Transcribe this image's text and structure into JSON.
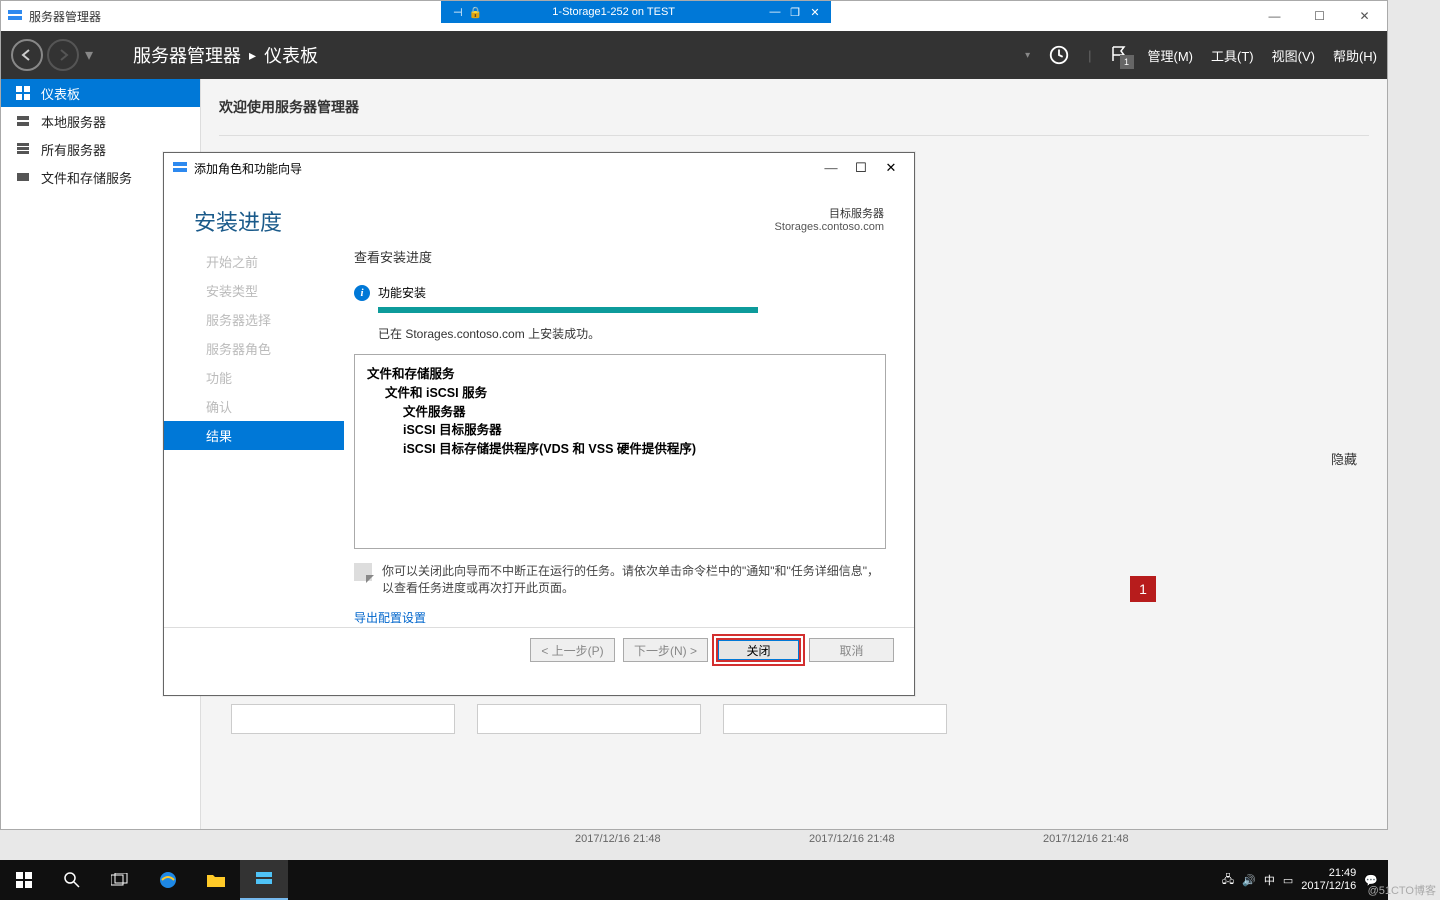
{
  "outer_window": {
    "title": "服务器管理器"
  },
  "remote_bar": {
    "title": "1-Storage1-252 on TEST"
  },
  "sm_header": {
    "breadcrumb": {
      "part1": "服务器管理器",
      "part2": "仪表板"
    },
    "menu": {
      "manage": "管理(M)",
      "tools": "工具(T)",
      "view": "视图(V)",
      "help": "帮助(H)"
    },
    "flag_count": "1"
  },
  "sidebar": {
    "items": [
      {
        "label": "仪表板"
      },
      {
        "label": "本地服务器"
      },
      {
        "label": "所有服务器"
      },
      {
        "label": "文件和存储服务"
      }
    ]
  },
  "main": {
    "welcome": "欢迎使用服务器管理器",
    "hide": "隐藏",
    "date1": "2017/12/16 21:48",
    "date2": "2017/12/16 21:48",
    "date3": "2017/12/16 21:48",
    "red_badge": "1"
  },
  "wizard": {
    "title": "添加角色和功能向导",
    "heading": "安装进度",
    "target_label": "目标服务器",
    "target_value": "Storages.contoso.com",
    "steps": {
      "before": "开始之前",
      "type": "安装类型",
      "server_sel": "服务器选择",
      "server_role": "服务器角色",
      "features": "功能",
      "confirm": "确认",
      "results": "结果"
    },
    "section_title": "查看安装进度",
    "install_label": "功能安装",
    "success_text": "已在 Storages.contoso.com 上安装成功。",
    "features_tree": {
      "l1": "文件和存储服务",
      "l2": "文件和 iSCSI 服务",
      "l3a": "文件服务器",
      "l3b": "iSCSI 目标服务器",
      "l3c": "iSCSI 目标存储提供程序(VDS 和 VSS 硬件提供程序)"
    },
    "note": "你可以关闭此向导而不中断正在运行的任务。请依次单击命令栏中的\"通知\"和\"任务详细信息\"，以查看任务进度或再次打开此页面。",
    "export_link": "导出配置设置",
    "buttons": {
      "prev": "< 上一步(P)",
      "next": "下一步(N) >",
      "close": "关闭",
      "cancel": "取消"
    }
  },
  "taskbar": {
    "clock_time": "21:49",
    "clock_date": "2017/12/16",
    "ime": "中"
  },
  "watermark": "@51CTO博客"
}
